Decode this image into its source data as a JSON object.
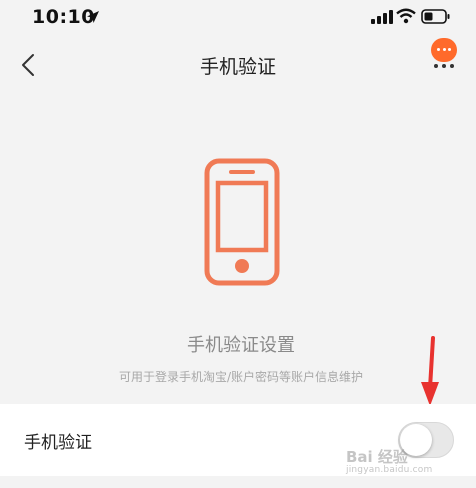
{
  "status_bar": {
    "time": "10:10",
    "icons": [
      "location-arrow-icon",
      "signal-icon",
      "wifi-icon",
      "battery-icon"
    ]
  },
  "nav": {
    "title": "手机验证",
    "back_icon": "chevron-left-icon",
    "more_icon": "more-menu-icon"
  },
  "illustration": {
    "icon": "phone-icon",
    "color": "#f07a55"
  },
  "section": {
    "title": "手机验证设置",
    "description": "可用于登录手机淘宝/账户密码等账户信息维护"
  },
  "setting": {
    "label": "手机验证",
    "enabled": false
  },
  "annotation": {
    "icon": "red-arrow-icon",
    "color": "#e8322f"
  },
  "watermark": {
    "logo": "Bai 经验",
    "url": "jingyan.baidu.com"
  },
  "colors": {
    "accent": "#ff6a2b",
    "background": "#f3f3f3"
  }
}
